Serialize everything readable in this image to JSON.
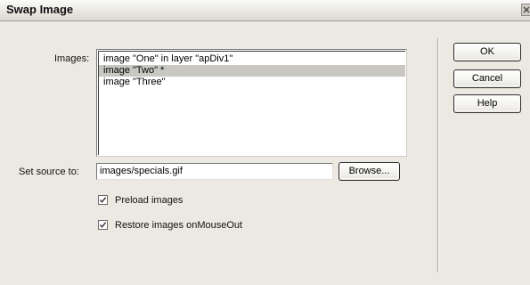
{
  "window": {
    "title": "Swap Image",
    "close_label": "Close"
  },
  "images": {
    "label": "Images:",
    "items": [
      {
        "text": "image \"One\" in layer \"apDiv1\"",
        "selected": false
      },
      {
        "text": "image \"Two\" *",
        "selected": true
      },
      {
        "text": "image \"Three\"",
        "selected": false
      }
    ]
  },
  "source": {
    "label": "Set source to:",
    "value": "images/specials.gif",
    "browse_label": "Browse..."
  },
  "options": {
    "preload": {
      "label": "Preload images",
      "checked": true
    },
    "restore": {
      "label": "Restore images onMouseOut",
      "checked": true
    }
  },
  "buttons": {
    "ok": "OK",
    "cancel": "Cancel",
    "help": "Help"
  },
  "colors": {
    "dialog_bg": "#ece9e2",
    "selection_bg": "#c9c7c2"
  }
}
